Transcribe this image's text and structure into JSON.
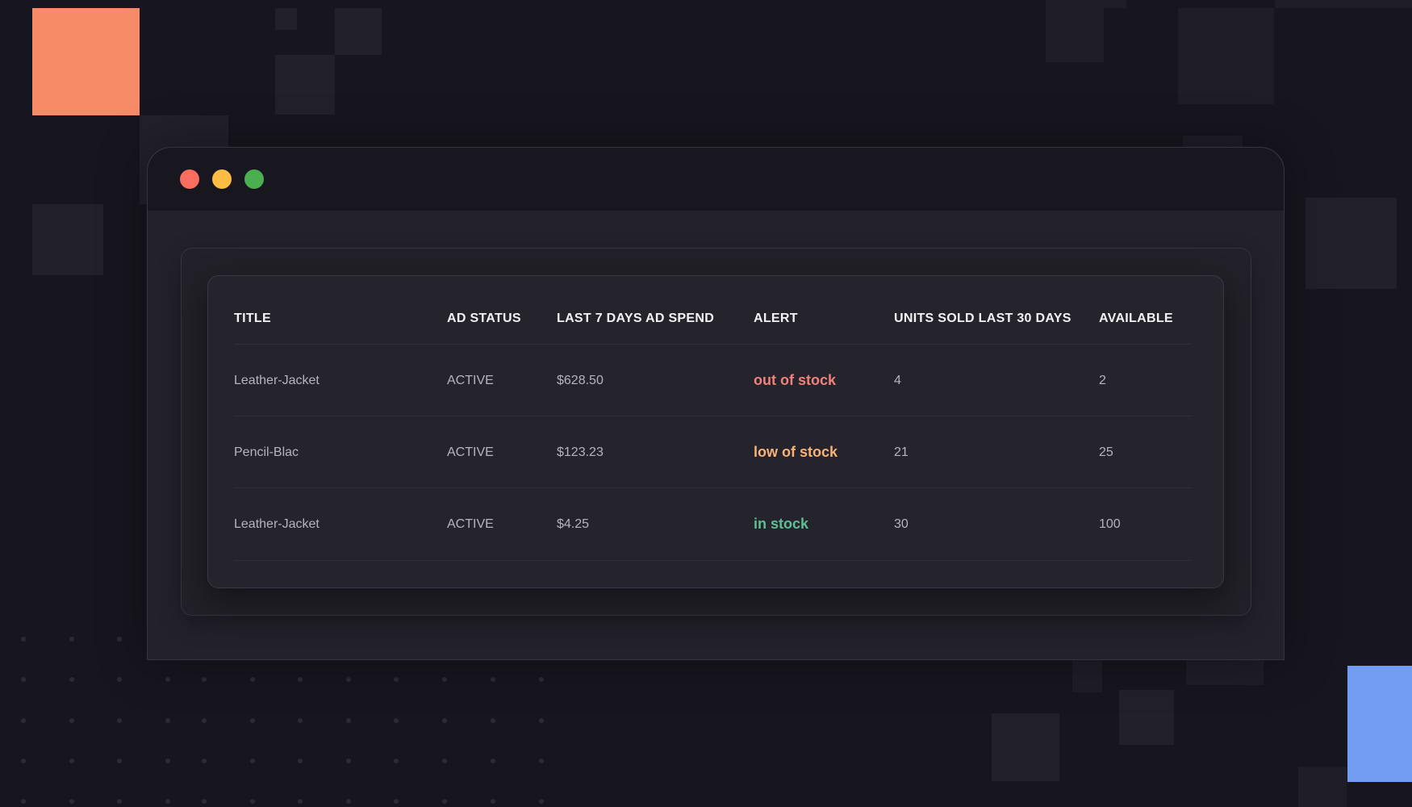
{
  "window": {
    "controls": [
      {
        "name": "close",
        "color": "#f96e5f"
      },
      {
        "name": "minimize",
        "color": "#fbbd44"
      },
      {
        "name": "maximize",
        "color": "#4caf4f"
      }
    ]
  },
  "table": {
    "columns": [
      "TITLE",
      "AD STATUS",
      "LAST 7 DAYS AD SPEND",
      "ALERT",
      "UNITS SOLD LAST 30 DAYS",
      "AVAILABLE"
    ],
    "rows": [
      {
        "title": "Leather-Jacket",
        "ad_status": "ACTIVE",
        "ad_spend": "$628.50",
        "alert": "out of stock",
        "units_sold": "4",
        "available": "2",
        "alert_color": "#f0827c"
      },
      {
        "title": "Pencil-Blac",
        "ad_status": "ACTIVE",
        "ad_spend": "$123.23",
        "alert": "low of stock",
        "units_sold": "21",
        "available": "25",
        "alert_color": "#f7b37a"
      },
      {
        "title": "Leather-Jacket",
        "ad_status": "ACTIVE",
        "ad_spend": "$4.25",
        "alert": "in stock",
        "units_sold": "30",
        "available": "100",
        "alert_color": "#5fbf95"
      }
    ]
  },
  "colors": {
    "background": "#17161f",
    "accent_orange": "#f78b67",
    "accent_blue": "#729df2"
  }
}
